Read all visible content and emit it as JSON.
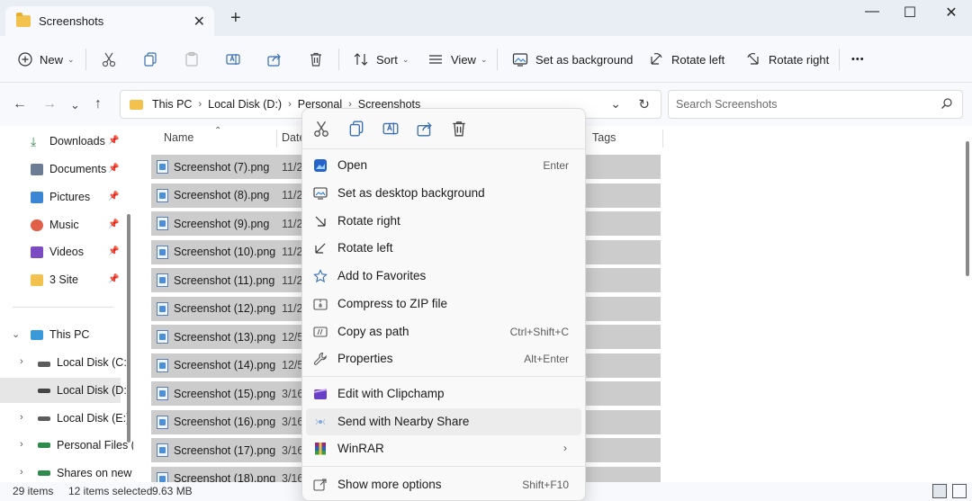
{
  "window": {
    "tab_title": "Screenshots",
    "tab_close": "✕",
    "new_tab": "+",
    "minimize": "—",
    "maximize": "☐",
    "close": "✕"
  },
  "toolbar": {
    "new_label": "New",
    "sort_label": "Sort",
    "view_label": "View",
    "set_background_label": "Set as background",
    "rotate_left_label": "Rotate left",
    "rotate_right_label": "Rotate right",
    "more_label": "•••"
  },
  "address": {
    "crumbs": [
      "This PC",
      "Local Disk (D:)",
      "Personal",
      "Screenshots"
    ],
    "search_placeholder": "Search Screenshots"
  },
  "sidebar": {
    "quick": [
      {
        "label": "Downloads",
        "color": "#2f8a4e"
      },
      {
        "label": "Documents",
        "color": "#6b7c93"
      },
      {
        "label": "Pictures",
        "color": "#3a86d4"
      },
      {
        "label": "Music",
        "color": "#e0604a"
      },
      {
        "label": "Videos",
        "color": "#7a4bc2"
      },
      {
        "label": "3 Site",
        "color": "#f2c14e"
      }
    ],
    "this_pc": "This PC",
    "drives": [
      {
        "label": "Local Disk (C:)"
      },
      {
        "label": "Local Disk (D:)",
        "selected": true
      },
      {
        "label": "Local Disk (E:)"
      },
      {
        "label": "Personal Files ("
      },
      {
        "label": "Shares on new"
      }
    ]
  },
  "filelist": {
    "columns": {
      "name": "Name",
      "date": "Date",
      "tags": "Tags"
    },
    "rows": [
      {
        "name": "Screenshot (7).png",
        "date": "11/2"
      },
      {
        "name": "Screenshot (8).png",
        "date": "11/2"
      },
      {
        "name": "Screenshot (9).png",
        "date": "11/2"
      },
      {
        "name": "Screenshot (10).png",
        "date": "11/2"
      },
      {
        "name": "Screenshot (11).png",
        "date": "11/2"
      },
      {
        "name": "Screenshot (12).png",
        "date": "11/2"
      },
      {
        "name": "Screenshot (13).png",
        "date": "12/5"
      },
      {
        "name": "Screenshot (14).png",
        "date": "12/5"
      },
      {
        "name": "Screenshot (15).png",
        "date": "3/16"
      },
      {
        "name": "Screenshot (16).png",
        "date": "3/16"
      },
      {
        "name": "Screenshot (17).png",
        "date": "3/16"
      },
      {
        "name": "Screenshot (18).png",
        "date": "3/16"
      }
    ]
  },
  "status": {
    "items": "29 items",
    "selected": "12 items selected",
    "size": "9.63 MB"
  },
  "context_menu": {
    "items": [
      {
        "label": "Open",
        "shortcut": "Enter"
      },
      {
        "label": "Set as desktop background",
        "shortcut": ""
      },
      {
        "label": "Rotate right",
        "shortcut": ""
      },
      {
        "label": "Rotate left",
        "shortcut": ""
      },
      {
        "label": "Add to Favorites",
        "shortcut": ""
      },
      {
        "label": "Compress to ZIP file",
        "shortcut": ""
      },
      {
        "label": "Copy as path",
        "shortcut": "Ctrl+Shift+C"
      },
      {
        "label": "Properties",
        "shortcut": "Alt+Enter"
      },
      {
        "label": "Edit with Clipchamp",
        "shortcut": ""
      },
      {
        "label": "Send with Nearby Share",
        "shortcut": ""
      },
      {
        "label": "WinRAR",
        "shortcut": ""
      },
      {
        "label": "Show more options",
        "shortcut": "Shift+F10"
      }
    ],
    "submenu_arrow": "›"
  }
}
